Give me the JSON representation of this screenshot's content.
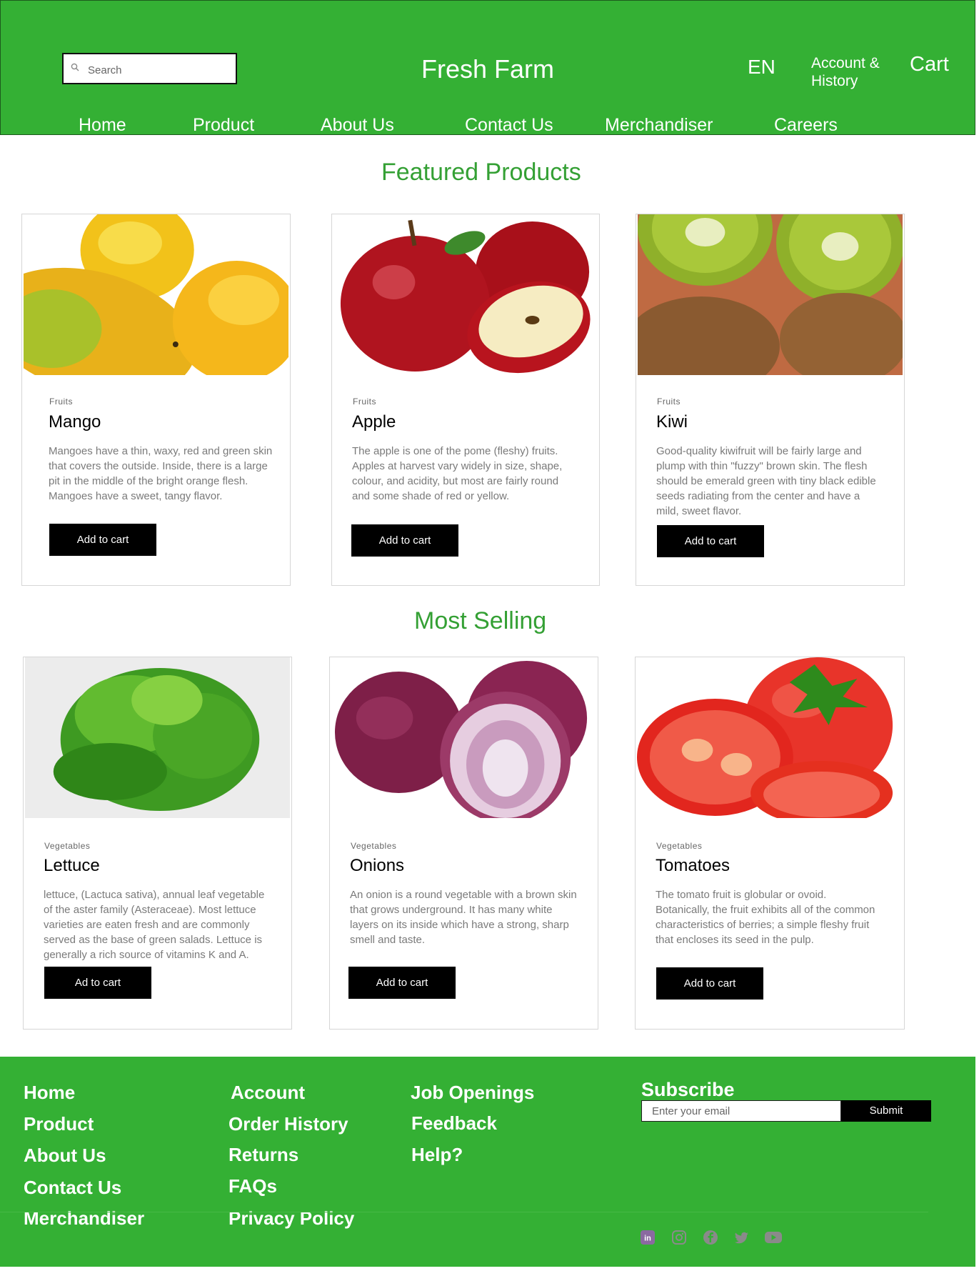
{
  "header": {
    "brand": "Fresh Farm",
    "search_placeholder": "Search",
    "language": "EN",
    "account_label": "Account & History",
    "cart_label": "Cart",
    "nav": [
      "Home",
      "Product",
      "About Us",
      "Contact Us",
      "Merchandiser",
      "Careers"
    ]
  },
  "featured": {
    "title": "Featured Products",
    "products": [
      {
        "category": "Fruits",
        "name": "Mango",
        "description": "Mangoes have a thin, waxy, red and green skin that covers the outside. Inside, there is a large pit in the middle of the bright orange flesh. Mangoes have a sweet, tangy flavor.",
        "button": "Add to cart"
      },
      {
        "category": "Fruits",
        "name": "Apple",
        "description": "The apple is one of the pome (fleshy) fruits. Apples at harvest vary widely in size, shape, colour, and acidity, but most are fairly round and some shade of red or yellow.",
        "button": "Add to cart"
      },
      {
        "category": "Fruits",
        "name": "Kiwi",
        "description": "Good-quality kiwifruit will be fairly large and plump with thin \"fuzzy\" brown skin. The flesh should be emerald green with tiny black edible seeds radiating from the center and have a mild, sweet flavor.",
        "button": "Add to cart"
      }
    ]
  },
  "most_selling": {
    "title": "Most Selling",
    "products": [
      {
        "category": "Vegetables",
        "name": "Lettuce",
        "description": "lettuce, (Lactuca sativa), annual leaf vegetable of the aster family (Asteraceae). Most lettuce varieties are eaten fresh and are commonly served as the base of green salads. Lettuce is generally a rich source of vitamins K and A.",
        "button": "Ad to cart"
      },
      {
        "category": "Vegetables",
        "name": "Onions",
        "description": "An onion is a round vegetable with a brown skin that grows underground. It has many white layers on its inside which have a strong, sharp smell and taste.",
        "button": "Add to cart"
      },
      {
        "category": "Vegetables",
        "name": "Tomatoes",
        "description": "The tomato fruit is globular or ovoid. Botanically, the fruit exhibits all of the common characteristics of berries; a simple fleshy fruit that encloses its seed in the pulp.",
        "button": "Add to cart"
      }
    ]
  },
  "footer": {
    "col1": [
      "Home",
      "Product",
      "About Us",
      "Contact Us",
      "Merchandiser"
    ],
    "col2": [
      "Account",
      "Order History",
      "Returns",
      "FAQs",
      "Privacy Policy"
    ],
    "col3": [
      "Job Openings",
      "Feedback",
      "Help?"
    ],
    "subscribe_title": "Subscribe",
    "email_placeholder": "Enter your email",
    "submit_label": "Submit",
    "social_icons": [
      "linkedin-icon",
      "instagram-icon",
      "facebook-icon",
      "twitter-icon",
      "youtube-icon"
    ]
  },
  "colors": {
    "brand_green": "#34b034",
    "title_green": "#34a034",
    "button_black": "#000000"
  }
}
